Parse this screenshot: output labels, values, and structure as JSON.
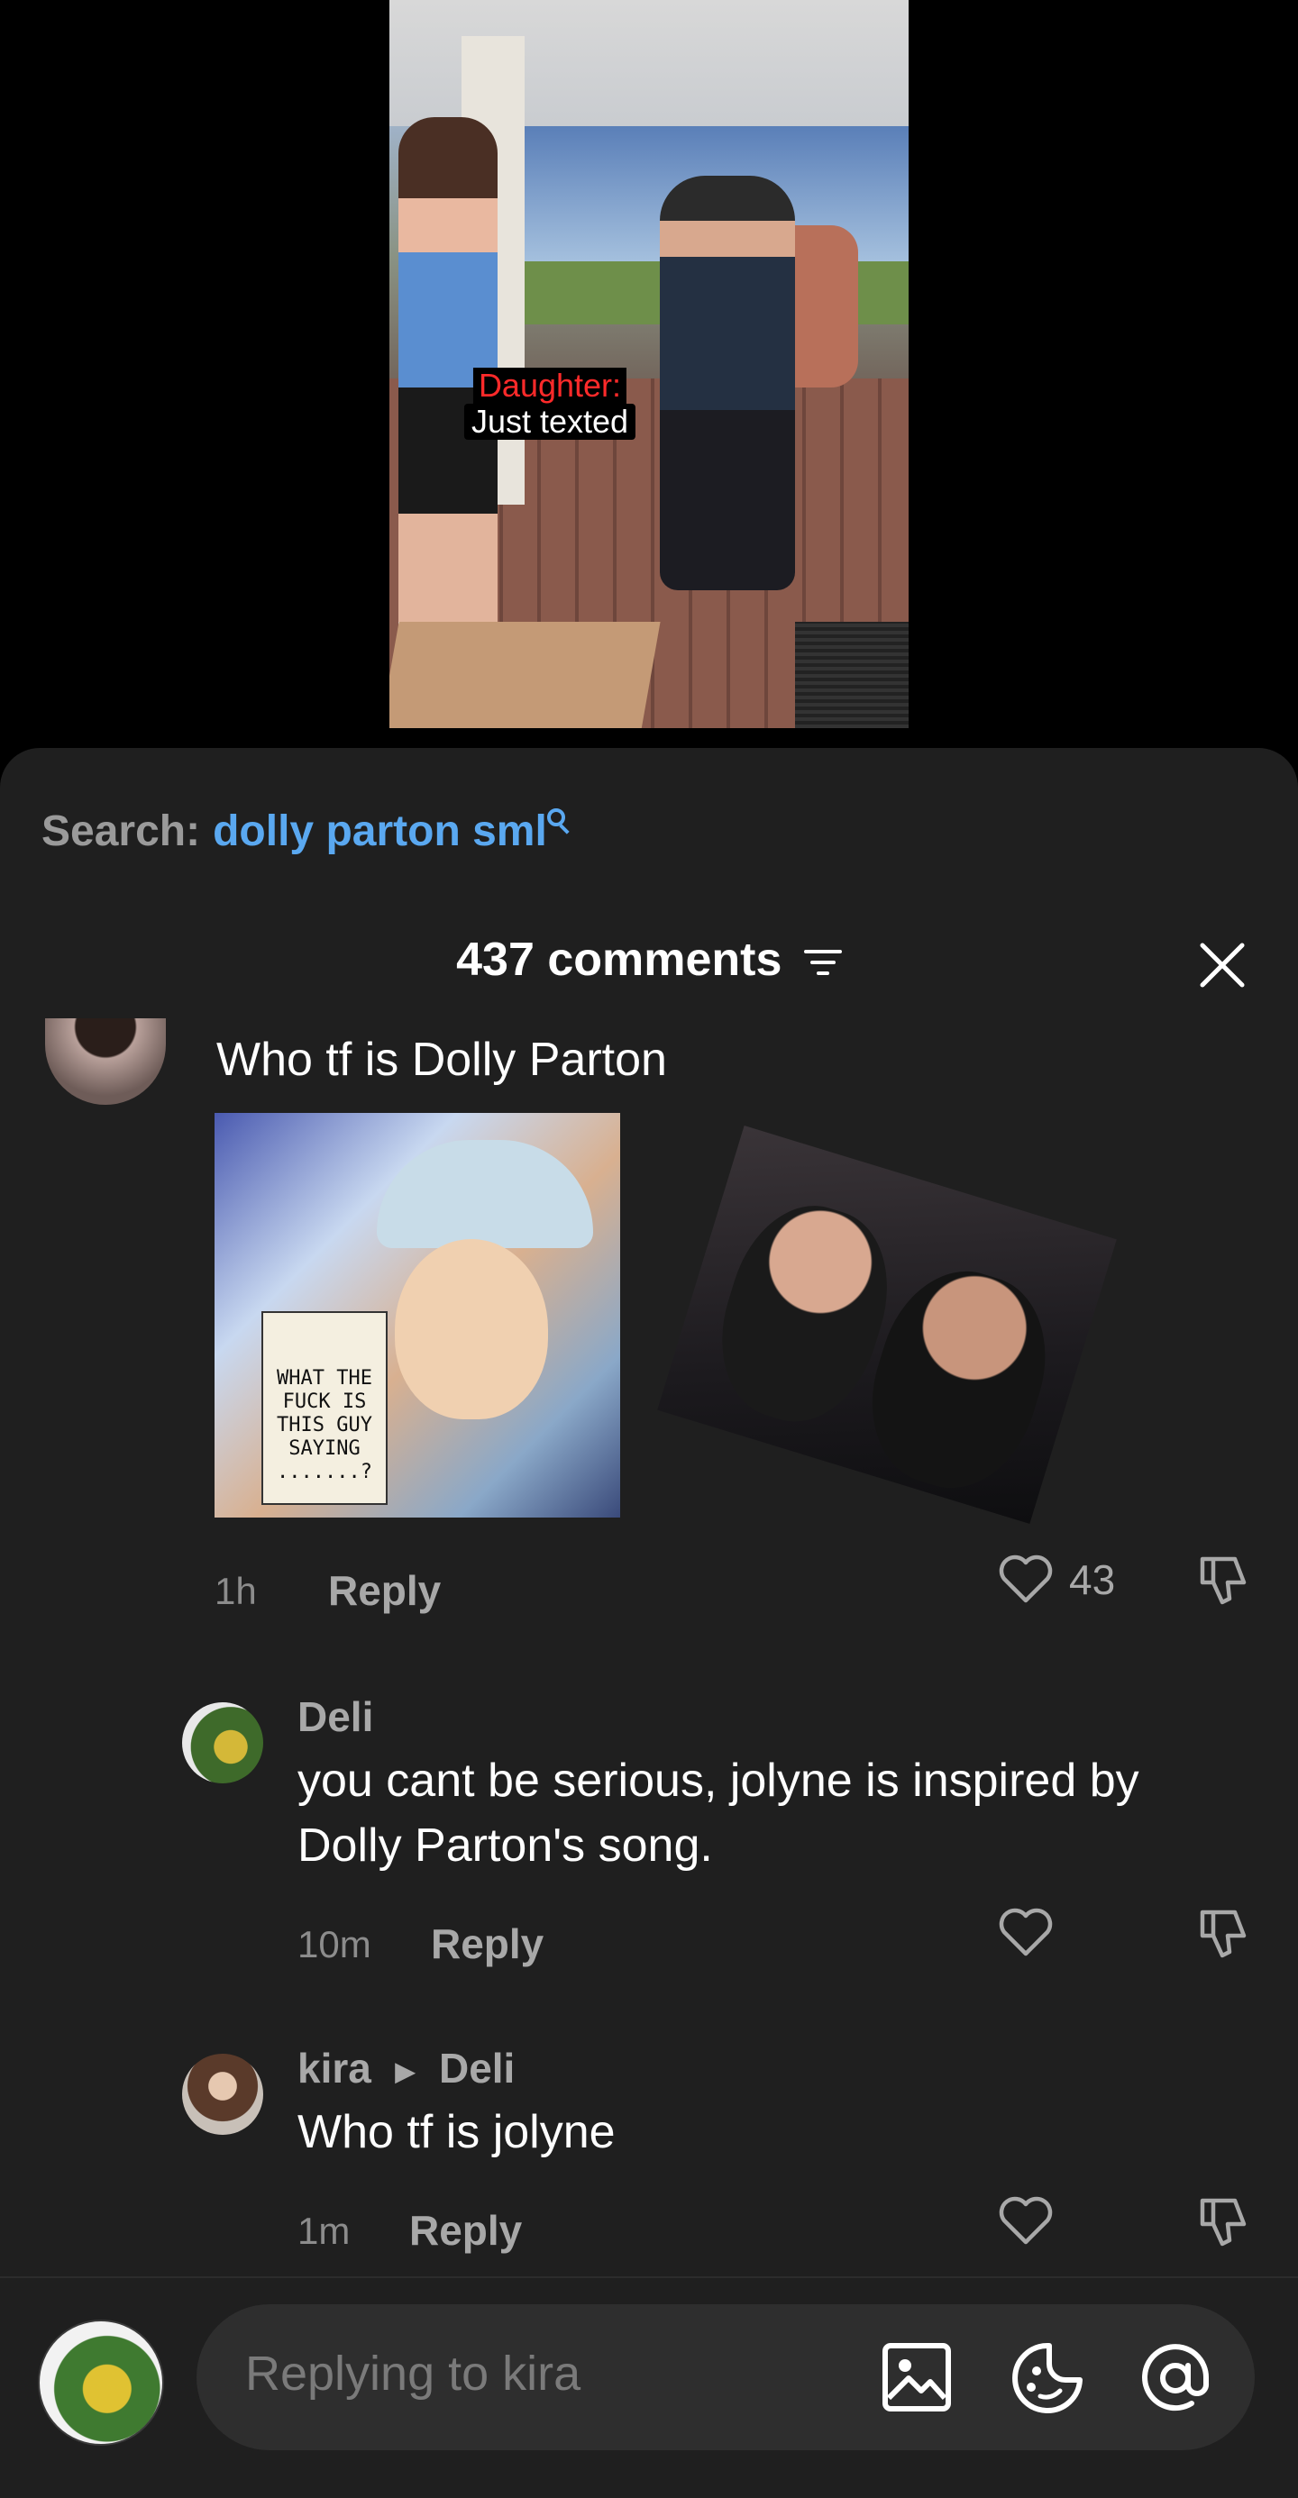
{
  "video": {
    "caption_line1": "Daughter:",
    "caption_line2": "Just texted"
  },
  "search": {
    "label": "Search:",
    "query": "dolly parton sml"
  },
  "comments_header": {
    "title": "437 comments"
  },
  "comments": [
    {
      "text": "Who tf is Dolly Parton",
      "image1_caption": "WHAT THE FUCK IS THIS GUY SAYING .......?",
      "time": "1h",
      "reply_label": "Reply",
      "likes": "43"
    },
    {
      "author": "Deli",
      "text": "you cant be serious, jolyne is inspired by Dolly Parton's song.",
      "time": "10m",
      "reply_label": "Reply"
    },
    {
      "author": "kira",
      "reply_to": "Deli",
      "text": "Who tf is jolyne",
      "time": "1m",
      "reply_label": "Reply"
    }
  ],
  "composer": {
    "placeholder": "Replying to kira"
  },
  "colors": {
    "sheet_bg": "#1f1f1f",
    "search_query": "#5aa8f0",
    "caption_red": "#ff2a2a"
  },
  "icons": [
    "search-icon",
    "filter-icon",
    "close-icon",
    "heart-icon",
    "dislike-icon",
    "image-icon",
    "sticker-icon",
    "mention-icon"
  ]
}
